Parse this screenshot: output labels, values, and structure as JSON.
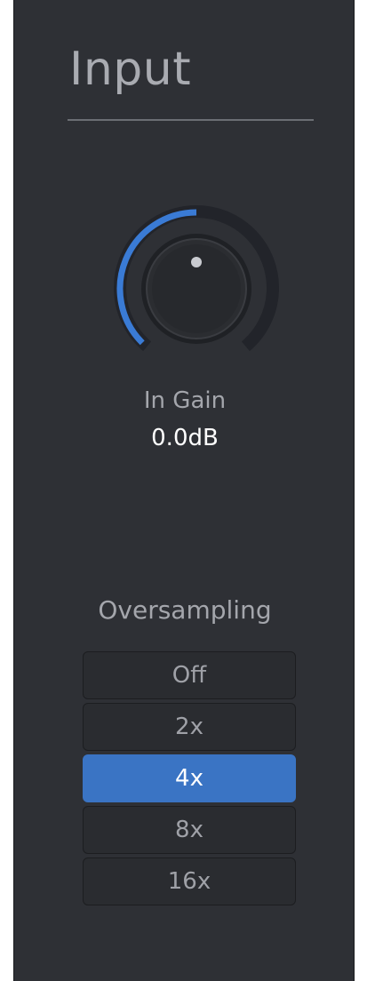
{
  "panel": {
    "title": "Input"
  },
  "gain_knob": {
    "label": "In Gain",
    "value": "0.0dB",
    "level_fraction": 0.5,
    "arc_color": "#3a7bd5"
  },
  "oversampling": {
    "label": "Oversampling",
    "options": [
      "Off",
      "2x",
      "4x",
      "8x",
      "16x"
    ],
    "selected": "4x",
    "selected_color": "#3a74c4"
  }
}
